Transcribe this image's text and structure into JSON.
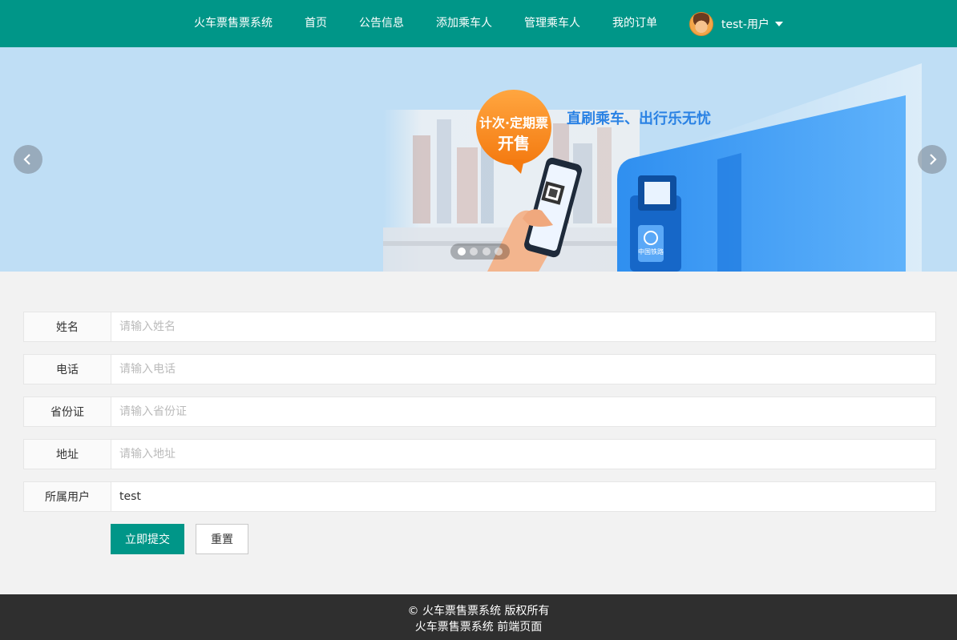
{
  "nav": {
    "brand": "火车票售票系统",
    "items": [
      "首页",
      "公告信息",
      "添加乘车人",
      "管理乘车人",
      "我的订单"
    ],
    "user_label": "test-用户"
  },
  "banner": {
    "bubble_line1": "计次·定期票",
    "bubble_line2": "开售",
    "slogan": "直刷乘车、出行乐无忧",
    "machine_badge": "中国铁路",
    "slide_count": 4,
    "active_slide": 0
  },
  "form": {
    "fields": [
      {
        "label": "姓名",
        "placeholder": "请输入姓名",
        "value": ""
      },
      {
        "label": "电话",
        "placeholder": "请输入电话",
        "value": ""
      },
      {
        "label": "省份证",
        "placeholder": "请输入省份证",
        "value": ""
      },
      {
        "label": "地址",
        "placeholder": "请输入地址",
        "value": ""
      },
      {
        "label": "所属用户",
        "placeholder": "",
        "value": "test"
      }
    ],
    "submit_label": "立即提交",
    "reset_label": "重置"
  },
  "footer": {
    "line1": "© 火车票售票系统 版权所有",
    "line2": "火车票售票系统 前端页面"
  },
  "colors": {
    "primary": "#009688",
    "banner_bg": "#bfdef5",
    "footer_bg": "#2f2f2f"
  }
}
